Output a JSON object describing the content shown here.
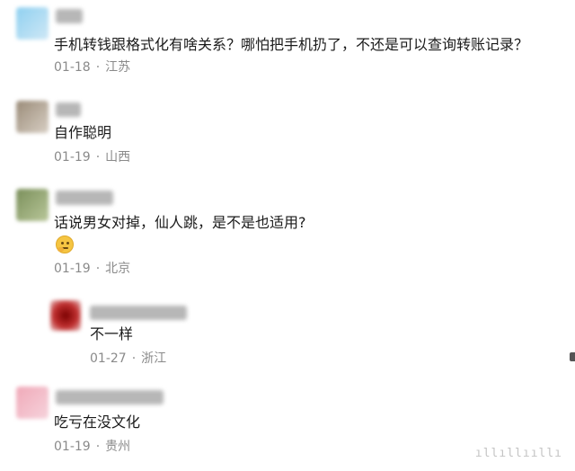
{
  "comments": [
    {
      "text": "手机转钱跟格式化有啥关系？哪怕把手机扔了，不还是可以查询转账记录？",
      "date": "01-18",
      "location": "江苏"
    },
    {
      "text": "自作聪明",
      "date": "01-19",
      "location": "山西"
    },
    {
      "text": "话说男女对掉，仙人跳，是不是也适用?",
      "emoji": "thinking-face-icon",
      "date": "01-19",
      "location": "北京",
      "reply": {
        "text": "不一样",
        "date": "01-27",
        "location": "浙江"
      }
    },
    {
      "text": "吃亏在没文化",
      "date": "01-19",
      "location": "贵州"
    }
  ],
  "separator": "·",
  "watermark": "ıllıllııllı",
  "colors": {
    "meta": "#8a8a8a",
    "text": "#1b1b1b"
  }
}
